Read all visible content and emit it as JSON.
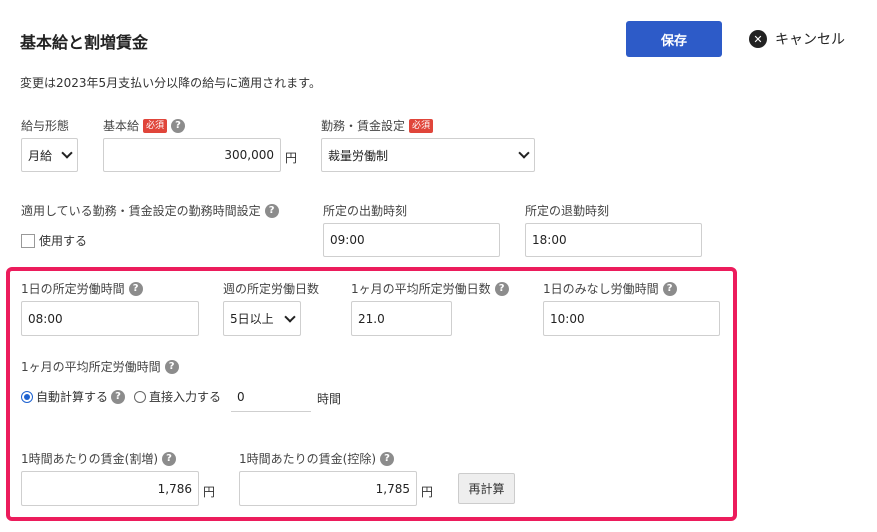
{
  "header": {
    "title": "基本給と割増賃金",
    "save_label": "保存",
    "cancel_label": "キャンセル"
  },
  "notice": "変更は2023年5月支払い分以降の給与に適用されます。",
  "row1": {
    "pay_type": {
      "label": "給与形態",
      "value": "月給"
    },
    "base_salary": {
      "label": "基本給",
      "required": "必須",
      "value": "300,000",
      "unit": "円"
    },
    "work_setting": {
      "label": "勤務・賃金設定",
      "required": "必須",
      "value": "裁量労働制"
    }
  },
  "row2": {
    "applied_label": "適用している勤務・賃金設定の勤務時間設定",
    "use_label": "使用する",
    "start_time": {
      "label": "所定の出勤時刻",
      "value": "09:00"
    },
    "end_time": {
      "label": "所定の退勤時刻",
      "value": "18:00"
    }
  },
  "highlight": {
    "daily_hours": {
      "label": "1日の所定労働時間",
      "value": "08:00"
    },
    "weekly_days": {
      "label": "週の所定労働日数",
      "value": "5日以上"
    },
    "monthly_avg_days": {
      "label": "1ヶ月の平均所定労働日数",
      "value": "21.0"
    },
    "deemed_hours": {
      "label": "1日のみなし労働時間",
      "value": "10:00"
    },
    "monthly_avg_hours_label": "1ヶ月の平均所定労働時間",
    "auto_calc_label": "自動計算する",
    "manual_label": "直接入力する",
    "manual_value": "0",
    "manual_unit": "時間",
    "hourly_increase": {
      "label": "1時間あたりの賃金(割増)",
      "value": "1,786",
      "unit": "円"
    },
    "hourly_deduct": {
      "label": "1時間あたりの賃金(控除)",
      "value": "1,785",
      "unit": "円"
    },
    "recalc_label": "再計算"
  },
  "colors": {
    "primary": "#2d5bc8",
    "highlight_border": "#ec1c5c",
    "required_badge": "#e0453a"
  }
}
